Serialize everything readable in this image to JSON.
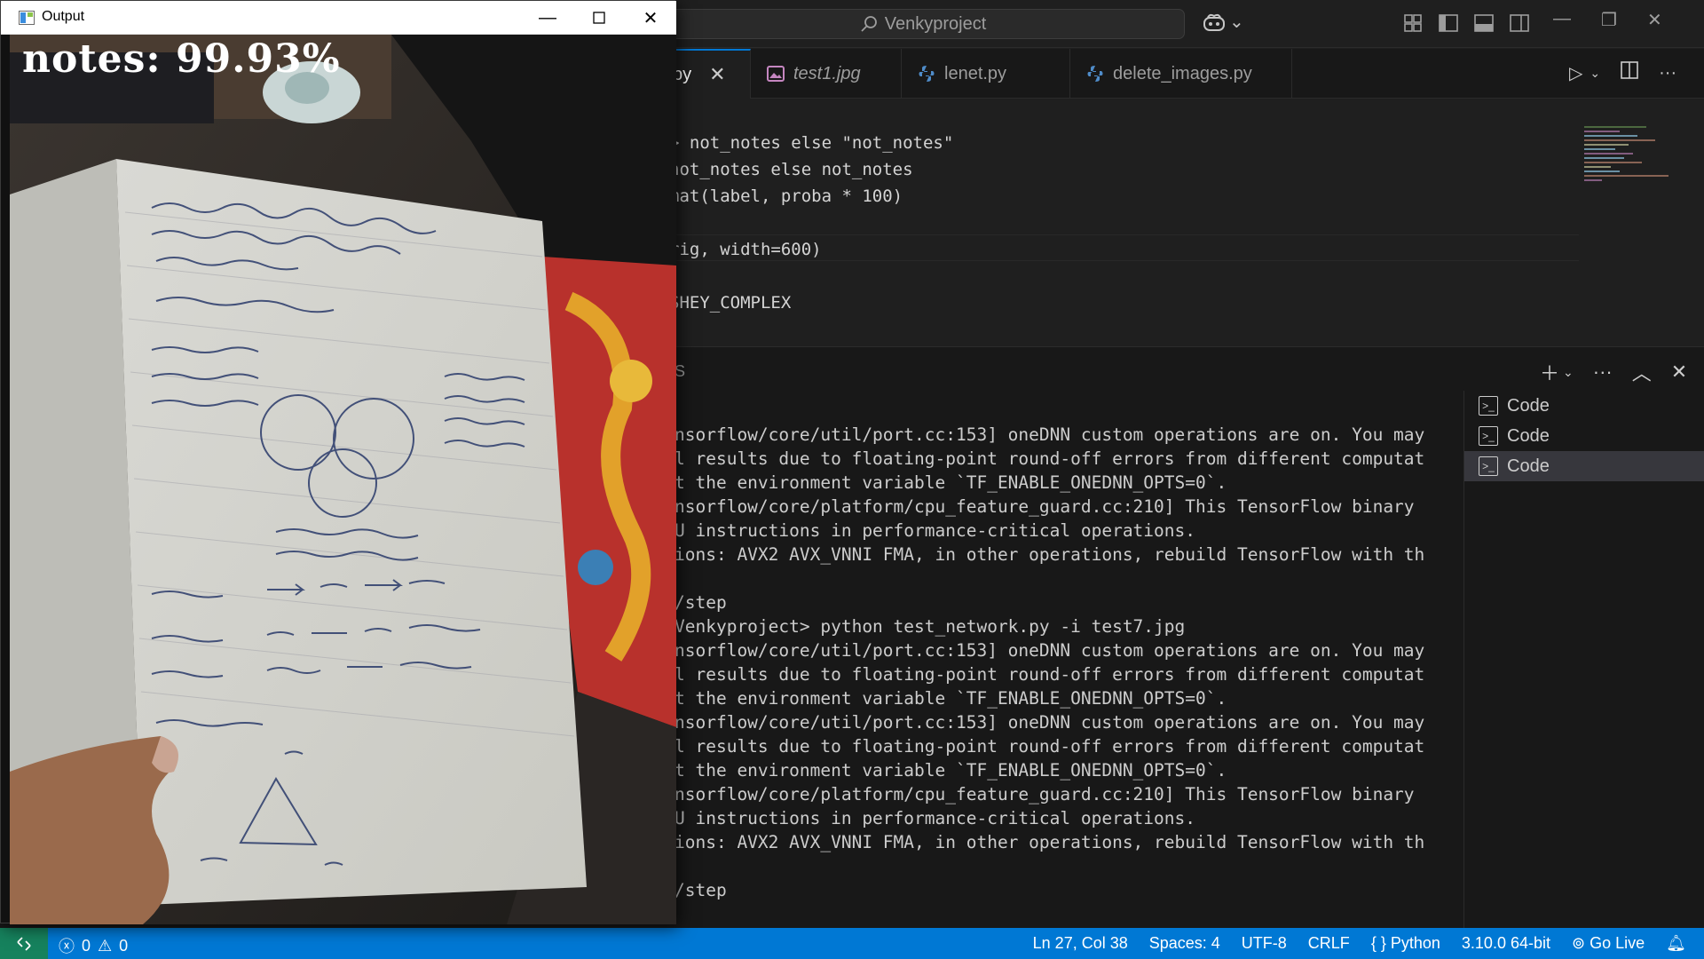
{
  "vscode": {
    "search_placeholder": "Venkyproject",
    "tabs": [
      {
        "label": "py",
        "active": true
      },
      {
        "label": "test1.jpg",
        "active": false
      },
      {
        "label": "lenet.py",
        "active": false
      },
      {
        "label": "delete_images.py",
        "active": false
      }
    ],
    "code_lines": [
      "> not_notes else \"not_notes\"",
      "not_notes else not_notes",
      "mat(label, proba * 100)",
      "",
      "rig, width=600)",
      "",
      "SHEY_COMPLEX"
    ],
    "panel_title_fragment": "S",
    "terminal_lines": [
      "nsorflow/core/util/port.cc:153] oneDNN custom operations are on. You may",
      "l results due to floating-point round-off errors from different computat",
      "t the environment variable `TF_ENABLE_ONEDNN_OPTS=0`.",
      "nsorflow/core/platform/cpu_feature_guard.cc:210] This TensorFlow binary",
      "U instructions in performance-critical operations.",
      "ions: AVX2 AVX_VNNI FMA, in other operations, rebuild TensorFlow with th",
      "",
      "/step",
      "Venkyproject> python test_network.py -i test7.jpg",
      "nsorflow/core/util/port.cc:153] oneDNN custom operations are on. You may",
      "l results due to floating-point round-off errors from different computat",
      "t the environment variable `TF_ENABLE_ONEDNN_OPTS=0`.",
      "nsorflow/core/util/port.cc:153] oneDNN custom operations are on. You may",
      "l results due to floating-point round-off errors from different computat",
      "t the environment variable `TF_ENABLE_ONEDNN_OPTS=0`.",
      "nsorflow/core/platform/cpu_feature_guard.cc:210] This TensorFlow binary",
      "U instructions in performance-critical operations.",
      "ions: AVX2 AVX_VNNI FMA, in other operations, rebuild TensorFlow with th",
      "",
      "/step"
    ],
    "terminal_instances": [
      "Code",
      "Code",
      "Code"
    ],
    "status": {
      "errors": "0",
      "warnings": "0",
      "position": "Ln 27, Col 38",
      "spaces": "Spaces: 4",
      "encoding": "UTF-8",
      "eol": "CRLF",
      "language": "Python",
      "interpreter": "3.10.0 64-bit",
      "golive": "Go Live"
    }
  },
  "output_window": {
    "title": "Output",
    "result_text": "notes: 99.93%"
  },
  "colors": {
    "accent": "#0078d4",
    "remote": "#16825d",
    "editor_bg": "#1f1f1f",
    "panel_bg": "#181818"
  }
}
